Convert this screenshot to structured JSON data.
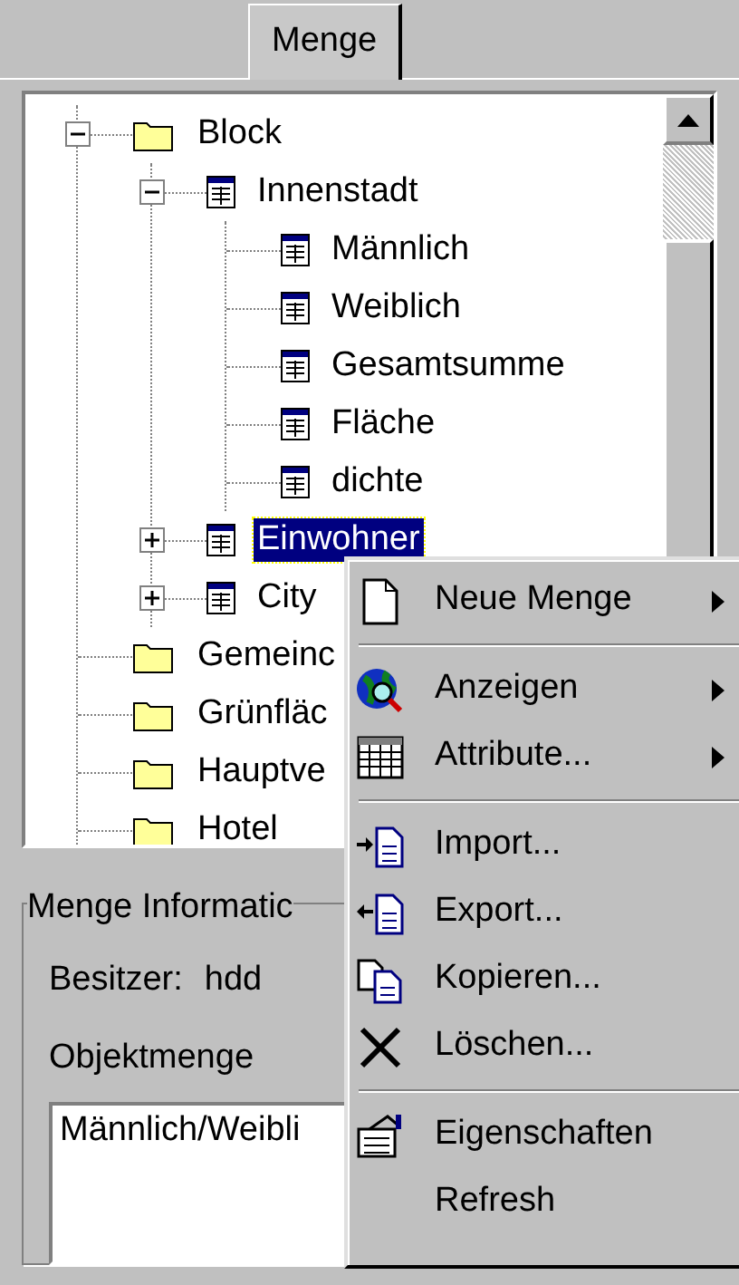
{
  "tabs": [
    {
      "label": "Menge",
      "selected": true
    }
  ],
  "tree": [
    {
      "label": "Block",
      "kind": "folder",
      "expanded": true,
      "selected": false,
      "children": [
        {
          "label": "Innenstadt",
          "kind": "table",
          "expanded": true,
          "selected": false,
          "children": [
            {
              "label": "Männlich",
              "kind": "table",
              "selected": false
            },
            {
              "label": "Weiblich",
              "kind": "table",
              "selected": false
            },
            {
              "label": "Gesamtsumme",
              "kind": "table",
              "selected": false
            },
            {
              "label": "Fläche",
              "kind": "table",
              "selected": false
            },
            {
              "label": "dichte",
              "kind": "table",
              "selected": false
            }
          ]
        },
        {
          "label": "Einwohner",
          "kind": "table",
          "expanded": false,
          "selected": true
        },
        {
          "label": "City",
          "kind": "table",
          "expanded": false,
          "selected": false
        }
      ]
    },
    {
      "label": "Gemeinc",
      "kind": "folder",
      "selected": false
    },
    {
      "label": "Grünfläc",
      "kind": "folder",
      "selected": false
    },
    {
      "label": "Hauptve",
      "kind": "folder",
      "selected": false
    },
    {
      "label": "Hotel",
      "kind": "folder",
      "selected": false
    }
  ],
  "info": {
    "title": "Menge Informatic",
    "owner_label": "Besitzer:",
    "owner": "hdd",
    "objects_label": "Objektmenge",
    "objects_value": "Männlich/Weibli"
  },
  "context_menu": [
    {
      "kind": "page",
      "label": "Neue Menge",
      "submenu": true
    },
    {
      "kind": "separator"
    },
    {
      "kind": "globe",
      "label": "Anzeigen",
      "submenu": true
    },
    {
      "kind": "grid",
      "label": "Attribute...",
      "submenu": true
    },
    {
      "kind": "separator"
    },
    {
      "kind": "import",
      "label": "Import...",
      "submenu": false
    },
    {
      "kind": "export",
      "label": "Export...",
      "submenu": false
    },
    {
      "kind": "copy",
      "label": "Kopieren...",
      "submenu": false
    },
    {
      "kind": "cross",
      "label": "Löschen...",
      "submenu": false
    },
    {
      "kind": "separator"
    },
    {
      "kind": "properties",
      "label": "Eigenschaften",
      "submenu": false
    },
    {
      "kind": "plain",
      "label": "Refresh",
      "submenu": false
    }
  ]
}
